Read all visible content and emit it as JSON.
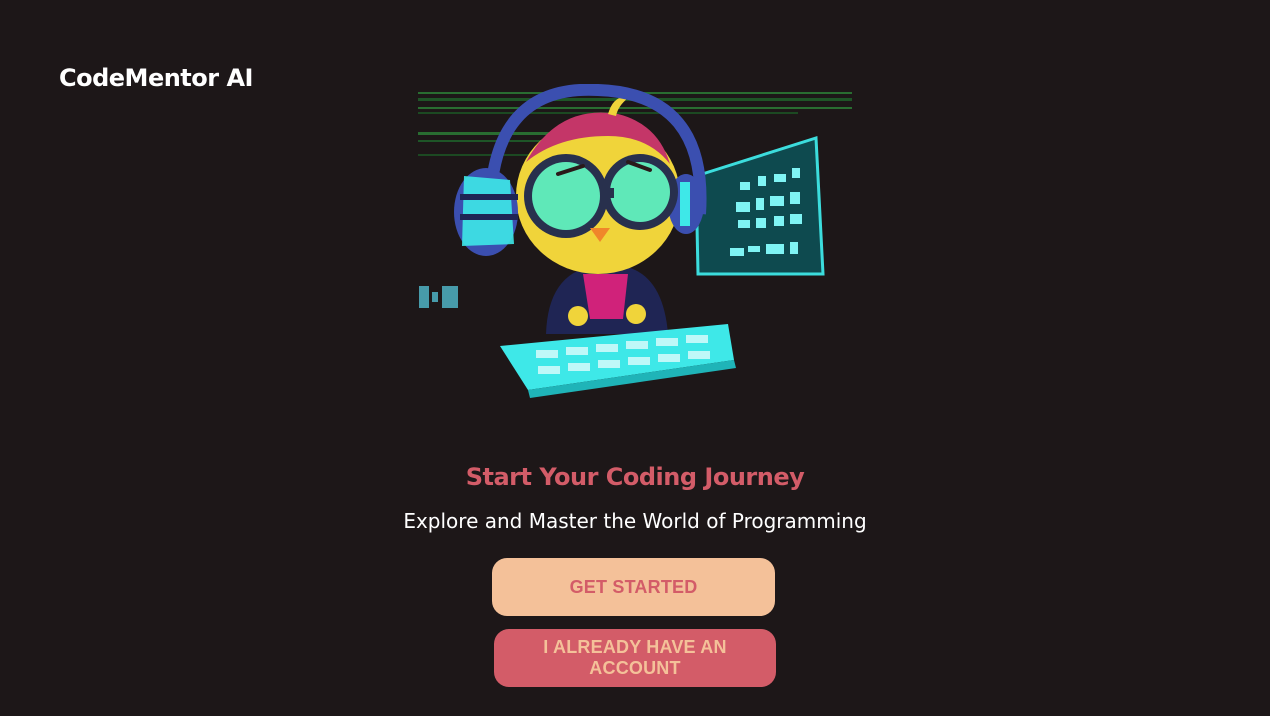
{
  "app": {
    "title": "CodeMentor AI"
  },
  "hero": {
    "illustration": "coding-bird-mascot"
  },
  "main": {
    "headline": "Start Your Coding Journey",
    "subline": "Explore and Master the World of Programming",
    "get_started_label": "GET STARTED",
    "have_account_label": "I ALREADY HAVE AN ACCOUNT"
  },
  "colors": {
    "background": "#1d1718",
    "accent_red": "#d35c68",
    "accent_peach": "#f4c199",
    "neon_cyan": "#3ee8e8"
  }
}
